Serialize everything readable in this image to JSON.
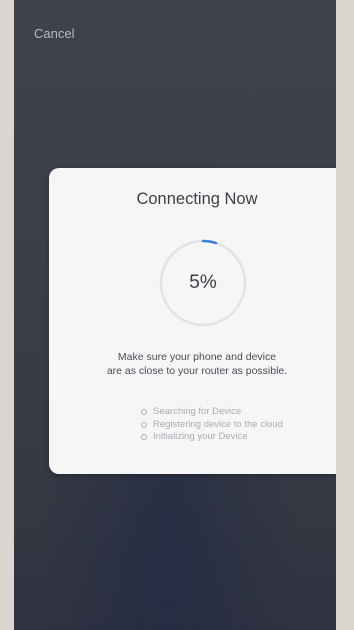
{
  "header": {
    "cancel_label": "Cancel"
  },
  "dialog": {
    "title": "Connecting Now",
    "progress": {
      "value": 5,
      "label": "5%"
    },
    "tip_line_1": "Make sure your phone and device",
    "tip_line_2": "are as close to your router as possible.",
    "steps": [
      "Searching for Device",
      "Registering device to the cloud",
      "Initializing your Device"
    ]
  },
  "colors": {
    "accent": "#3b7fd9",
    "ring_track": "#e2e3e6",
    "overlay": "#3a3e47",
    "card": "#f6f6f7"
  }
}
